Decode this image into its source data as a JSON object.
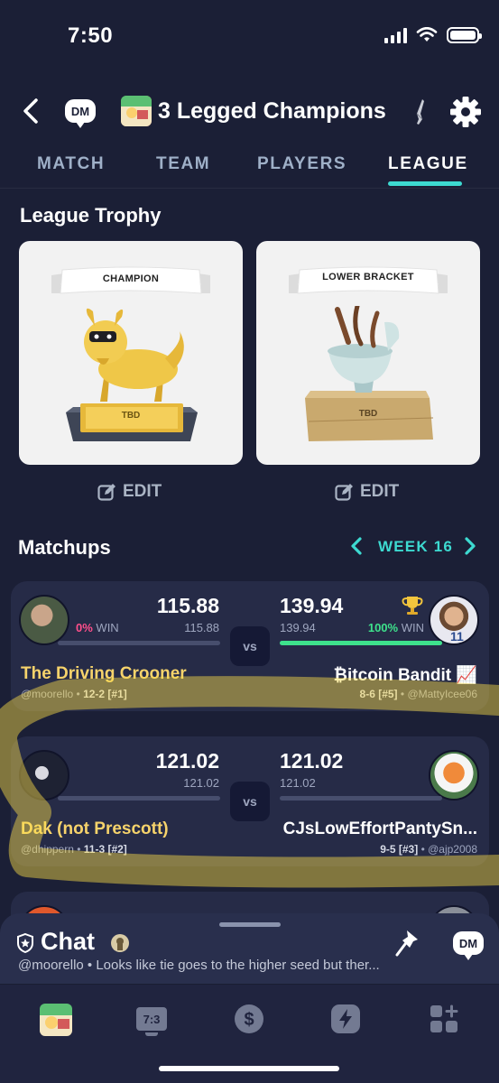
{
  "status_bar": {
    "time": "7:50"
  },
  "header": {
    "dm_label": "DM",
    "team_title": "3 Legged Champions"
  },
  "tabs": [
    {
      "label": "MATCH",
      "active": false
    },
    {
      "label": "TEAM",
      "active": false
    },
    {
      "label": "PLAYERS",
      "active": false
    },
    {
      "label": "LEAGUE",
      "active": true
    }
  ],
  "league_trophy": {
    "title": "League Trophy",
    "trophies": [
      {
        "banner": "CHAMPION",
        "plate": "TBD",
        "edit_label": "EDIT"
      },
      {
        "banner": "LOWER BRACKET",
        "plate": "TBD",
        "edit_label": "EDIT"
      }
    ]
  },
  "matchups": {
    "title": "Matchups",
    "week_label": "WEEK 16",
    "vs_label": "vs",
    "games": [
      {
        "left": {
          "score": "115.88",
          "projected": "115.88",
          "win_pct": "0%",
          "win_label": "WIN",
          "name": "The Driving Crooner",
          "handle": "@moorello",
          "record": "12-2 [#1]"
        },
        "right": {
          "score": "139.94",
          "projected": "139.94",
          "win_pct": "100%",
          "win_label": "WIN",
          "name": "₿itcoin Bandit 📈",
          "handle": "@MattyIcee06",
          "record": "8-6 [#5]",
          "trophy": true
        }
      },
      {
        "left": {
          "score": "121.02",
          "projected": "121.02",
          "name": "Dak (not Prescott)",
          "handle": "@dhippern",
          "record": "11-3 [#2]"
        },
        "right": {
          "score": "121.02",
          "projected": "121.02",
          "name": "CJsLowEffortPantySn...",
          "handle": "@ajp2008",
          "record": "9-5 [#3]"
        }
      }
    ]
  },
  "chat": {
    "title": "Chat",
    "dm_label": "DM",
    "preview": "@moorello • Looks like tie goes to the higher seed but ther..."
  },
  "tab_bar": {
    "items": [
      {
        "icon": "team-avatar-icon"
      },
      {
        "icon": "scoreboard-icon",
        "label": "7:3"
      },
      {
        "icon": "dollar-icon"
      },
      {
        "icon": "lightning-icon"
      },
      {
        "icon": "add-widget-icon"
      }
    ]
  },
  "colors": {
    "background": "#1b1f36",
    "card": "#262b47",
    "accent_teal": "#3ddad1",
    "win_green": "#3ee28c",
    "loss_pink": "#ff4f8b",
    "gold_name": "#f6d36b"
  }
}
